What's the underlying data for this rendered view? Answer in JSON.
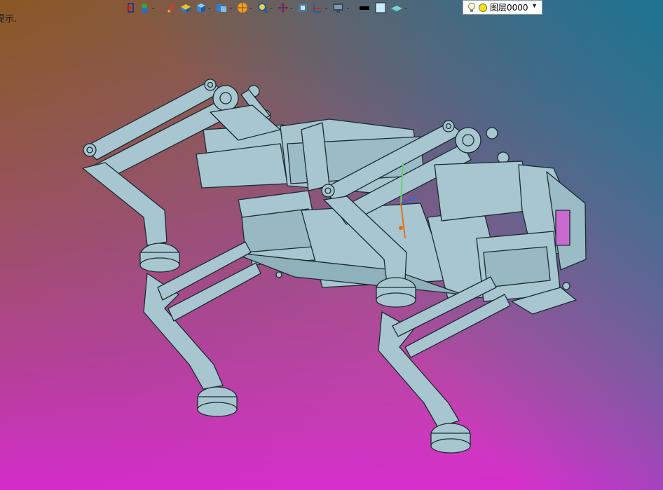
{
  "status": {
    "partial_text": "提示."
  },
  "toolbar": {
    "buttons": [
      {
        "icon": "exit-icon",
        "dropdown": false
      },
      {
        "icon": "import-part-icon",
        "dropdown": true
      },
      {
        "icon": "pencil-icon",
        "dropdown": false
      },
      {
        "icon": "solid-block-icon",
        "dropdown": false
      },
      {
        "icon": "cube-icon",
        "dropdown": true
      },
      {
        "icon": "extrude-icon",
        "dropdown": true
      },
      {
        "icon": "render-sphere-icon",
        "dropdown": true
      },
      {
        "icon": "zoom-icon",
        "dropdown": true
      },
      {
        "icon": "crosshair-icon",
        "dropdown": true
      },
      {
        "icon": "fit-view-icon",
        "dropdown": false
      },
      {
        "icon": "section-view-icon",
        "dropdown": true
      },
      {
        "icon": "display-monitor-icon",
        "dropdown": true
      },
      {
        "icon": "line-color-swatch-icon",
        "dropdown": false
      },
      {
        "icon": "fill-color-swatch-icon",
        "dropdown": false
      },
      {
        "icon": "surface-style-icon",
        "dropdown": true
      }
    ],
    "layer": {
      "name": "图层0000",
      "icons": [
        "lightbulb-icon",
        "layer-state-dot-icon"
      ]
    }
  },
  "colors": {
    "bg_top_left": "#8a5a2a",
    "bg_top_right": "#1f6f8a",
    "bg_bottom_left": "#e02ad2",
    "bg_bottom_right": "#a98dbf",
    "part_fill": "#a7c6cf",
    "part_edge": "#1a2a30"
  },
  "viewport": {
    "model_name": "quadruped-robot-assembly"
  }
}
